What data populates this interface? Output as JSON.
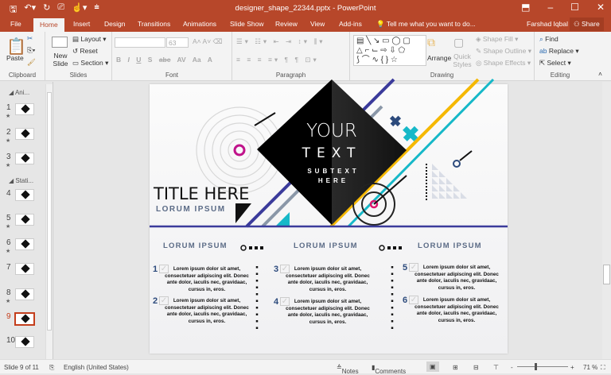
{
  "window": {
    "title": "designer_shape_22344.pptx - PowerPoint",
    "qat_icons": [
      "save-icon",
      "undo-icon",
      "redo-icon",
      "present-icon",
      "touch-mode-icon",
      "customize-icon"
    ]
  },
  "tabs": [
    "File",
    "Home",
    "Insert",
    "Design",
    "Transitions",
    "Animations",
    "Slide Show",
    "Review",
    "View",
    "Add-ins"
  ],
  "active_tab": "Home",
  "tell_me": "Tell me what you want to do...",
  "user": "Farshad Iqbal",
  "share": "Share",
  "ribbon": {
    "clipboard": {
      "label": "Clipboard",
      "paste": "Paste"
    },
    "slides": {
      "label": "Slides",
      "new_slide": "New Slide",
      "layout": "Layout",
      "reset": "Reset",
      "section": "Section"
    },
    "font": {
      "label": "Font",
      "font_name": "",
      "font_size": "63",
      "buttons": [
        "B",
        "I",
        "U",
        "S",
        "abc",
        "AV",
        "Aa",
        "A"
      ]
    },
    "paragraph": {
      "label": "Paragraph"
    },
    "drawing": {
      "label": "Drawing",
      "arrange": "Arrange",
      "quick_styles": "Quick Styles",
      "shape_fill": "Shape Fill",
      "shape_outline": "Shape Outline",
      "shape_effects": "Shape Effects"
    },
    "editing": {
      "label": "Editing",
      "find": "Find",
      "replace": "Replace",
      "select": "Select"
    }
  },
  "thumbnails": {
    "sections": [
      "Ani...",
      "Stati..."
    ],
    "slides": [
      {
        "n": "1",
        "star": true
      },
      {
        "n": "2",
        "star": true
      },
      {
        "n": "3",
        "star": true
      },
      {
        "n": "4",
        "star": false
      },
      {
        "n": "5",
        "star": true
      },
      {
        "n": "6",
        "star": true
      },
      {
        "n": "7",
        "star": false
      },
      {
        "n": "8",
        "star": true
      },
      {
        "n": "9",
        "star": false,
        "selected": true
      },
      {
        "n": "10",
        "star": false
      }
    ]
  },
  "slide": {
    "your": "YOUR",
    "text": "TEXT",
    "subtext1": "SUBTEXT",
    "subtext2": "HERE",
    "title": "TITLE HERE",
    "subtitle": "LORUM IPSUM",
    "headings": [
      "LORUM IPSUM",
      "LORUM IPSUM",
      "LORUM IPSUM"
    ],
    "items": [
      {
        "n": "1",
        "text": "Lorem ipsum dolor sit amet, consectetuer adipiscing elit. Donec ante dolor, iaculis nec, gravidaac, cursus in, eros."
      },
      {
        "n": "2",
        "text": "Lorem ipsum dolor sit amet, consectetuer adipiscing elit. Donec ante dolor, iaculis nec, gravidaac, cursus in, eros."
      },
      {
        "n": "3",
        "text": "Lorem ipsum dolor sit amet, consectetuer adipiscing elit. Donec ante dolor, iaculis nec, gravidaac, cursus in, eros."
      },
      {
        "n": "4",
        "text": "Lorem ipsum dolor sit amet, consectetuer adipiscing elit. Donec ante dolor, iaculis nec, gravidaac, cursus in, eros."
      },
      {
        "n": "5",
        "text": "Lorem ipsum dolor sit amet, consectetuer adipiscing elit. Donec ante dolor, iaculis nec, gravidaac, cursus in, eros."
      },
      {
        "n": "6",
        "text": "Lorem ipsum dolor sit amet, consectetuer adipiscing elit. Donec ante dolor, iaculis nec, gravidaac, cursus in, eros."
      }
    ],
    "colors": {
      "purple": "#3b3b9b",
      "yellow": "#f5b800",
      "teal": "#16b8c8",
      "magenta": "#c0138b",
      "navy": "#2c4a7c",
      "gray": "#8a97a8"
    }
  },
  "status": {
    "slide": "Slide 9 of 11",
    "language": "English (United States)",
    "notes": "Notes",
    "comments": "Comments",
    "zoom": "71 %",
    "zoom_level": 71
  },
  "colors": {
    "accent": "#b7472a"
  }
}
